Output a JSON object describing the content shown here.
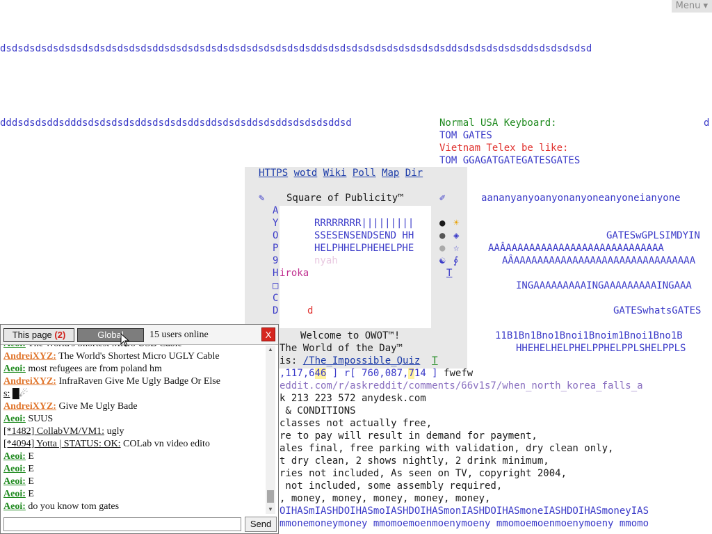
{
  "menu": {
    "label": "Menu ▾"
  },
  "canvas": {
    "line_top": "dsdsdsdsdsdsdsdsdsdsdsdsdsddsdsdsdsdsdsdsdsdsdsdsdsdsddsdsdsdsdsdsdsdsdsdsdsddsdsdsdsdsdsddsdsdsdsdsd",
    "line_mid": "dddsdsdsddsdddsdsdsdsdsddsdsdsdsddsddsdsdsddsdsddsdsdsdsddsd",
    "keyboard": {
      "normal_label": "Normal USA Keyboard:",
      "normal_value": "TOM GATES",
      "telex_label": "Vietnam Telex be like:",
      "telex_value": "TOM GGAGATGATEGATESGATES",
      "far_right": "d"
    },
    "nav_links": [
      "HTTPS",
      "wotd",
      "Wiki",
      "Poll",
      "Map",
      "Dir"
    ],
    "square_title": "Square of Publicity™",
    "left_letters": [
      "A",
      "Y",
      "O",
      "P",
      "9",
      "H",
      "□",
      "C",
      "D"
    ],
    "box_lines": [
      "RRRRRRRR|||||||||",
      "SSESENSENDSEND HH",
      "HELPHHELPHEHELPHE",
      "nyah"
    ],
    "hiroka": "iroka",
    "d_char": "d",
    "right_symbols": [
      "●",
      "●",
      "●",
      "☯",
      "T"
    ],
    "right_symbols2": [
      "☀",
      "◈",
      "☆",
      "∮"
    ],
    "anyone": "aananyanyoanyonanyoneanyoneianyone",
    "gates_line1": "GATESwGPLSIMDYIN",
    "a_line1": "AAÂAAAAAAAAAAAAAAAAAAAAAAAAAAA",
    "a_line2": "AÂAAAAAAAAAAAAAAAAAAAAAAAAAAAAAAA",
    "ing_line": "INGAAAAAAAAAINGAAAAAAAAAINGAAA",
    "gates_whats": "GATESwhatsGATES",
    "welcome": "Welcome to OWOT™!",
    "b_line": "11B1Bn1Bno1Bnoi1Bnoim1Bnoi1Bno1B",
    "world_of_day": "The World of the Day™",
    "hhe_line": "HHEHELHELPHELPPHELPPLSHELPPLS",
    "is_label": "is:",
    "is_link": "/The_Impossible_Quiz",
    "is_t": "T",
    "numbers_a": ",117,6",
    "numbers_b": "46",
    "numbers_c": " ] r[ 760,087,",
    "numbers_d": "7",
    "numbers_e": "14 ]",
    "numbers_f": "fwefw",
    "reddit": "eddit.com/r/askreddit/comments/66v1s7/when_north_korea_falls_a",
    "anydesk": "k 213 223 572 anydesk.com",
    "terms": [
      " & CONDITIONS",
      "classes not actually free,",
      "re to pay will result in demand for payment,",
      "ales final, free parking with validation, dry clean only,",
      "t dry clean, 2 shows nightly, 2 drink minimum,",
      "ries not included, As seen on TV, copyright 2004,",
      " not included, some assembly required,",
      ", money, money, money, money, money,"
    ],
    "money_line1": "OIHASmIASHDOIHASmoIASHDOIHASmonIASHDOIHASmoneIASHDOIHASmoneyIAS",
    "money_line2": "mmonemoneymoney mmomoemoenmoenymoeny mmomoemoenmoenymoeny mmomo"
  },
  "chat": {
    "tab_page_label": "This page",
    "tab_page_count": "(2)",
    "tab_global_label": "Global",
    "users_online": "15 users online",
    "close_label": "X",
    "messages": [
      {
        "user": "Aeoi:",
        "type": "g",
        "text": "The World's Shortest Micro USB Cable"
      },
      {
        "user": "AndreiXYZ:",
        "type": "a",
        "text": "The World's Shortest Micro UGLY Cable"
      },
      {
        "user": "Aeoi:",
        "type": "g",
        "text": "most refugees are from poland hm"
      },
      {
        "user": "AndreiXYZ:",
        "type": "a",
        "text": "InfraRaven Give Me Ugly Badge Or Else"
      },
      {
        "user": "s:",
        "type": "s",
        "text": "█☄"
      },
      {
        "user": "AndreiXYZ:",
        "type": "a",
        "text": "Give Me Ugly Bade"
      },
      {
        "user": "Aeoi:",
        "type": "g",
        "text": "SUUS"
      },
      {
        "user": "[*1482] CollabVM/VM1:",
        "type": "s",
        "text": "ugly"
      },
      {
        "user": "[*4094] Yotta | STATUS: OK:",
        "type": "s",
        "text": "COLab vn video edito"
      },
      {
        "user": "Aeoi:",
        "type": "g",
        "text": "E"
      },
      {
        "user": "Aeoi:",
        "type": "g",
        "text": "E"
      },
      {
        "user": "Aeoi:",
        "type": "g",
        "text": "E"
      },
      {
        "user": "Aeoi:",
        "type": "g",
        "text": "E"
      },
      {
        "user": "Aeoi:",
        "type": "g",
        "text": "do you know tom gates"
      }
    ],
    "input_value": "",
    "send_label": "Send"
  }
}
